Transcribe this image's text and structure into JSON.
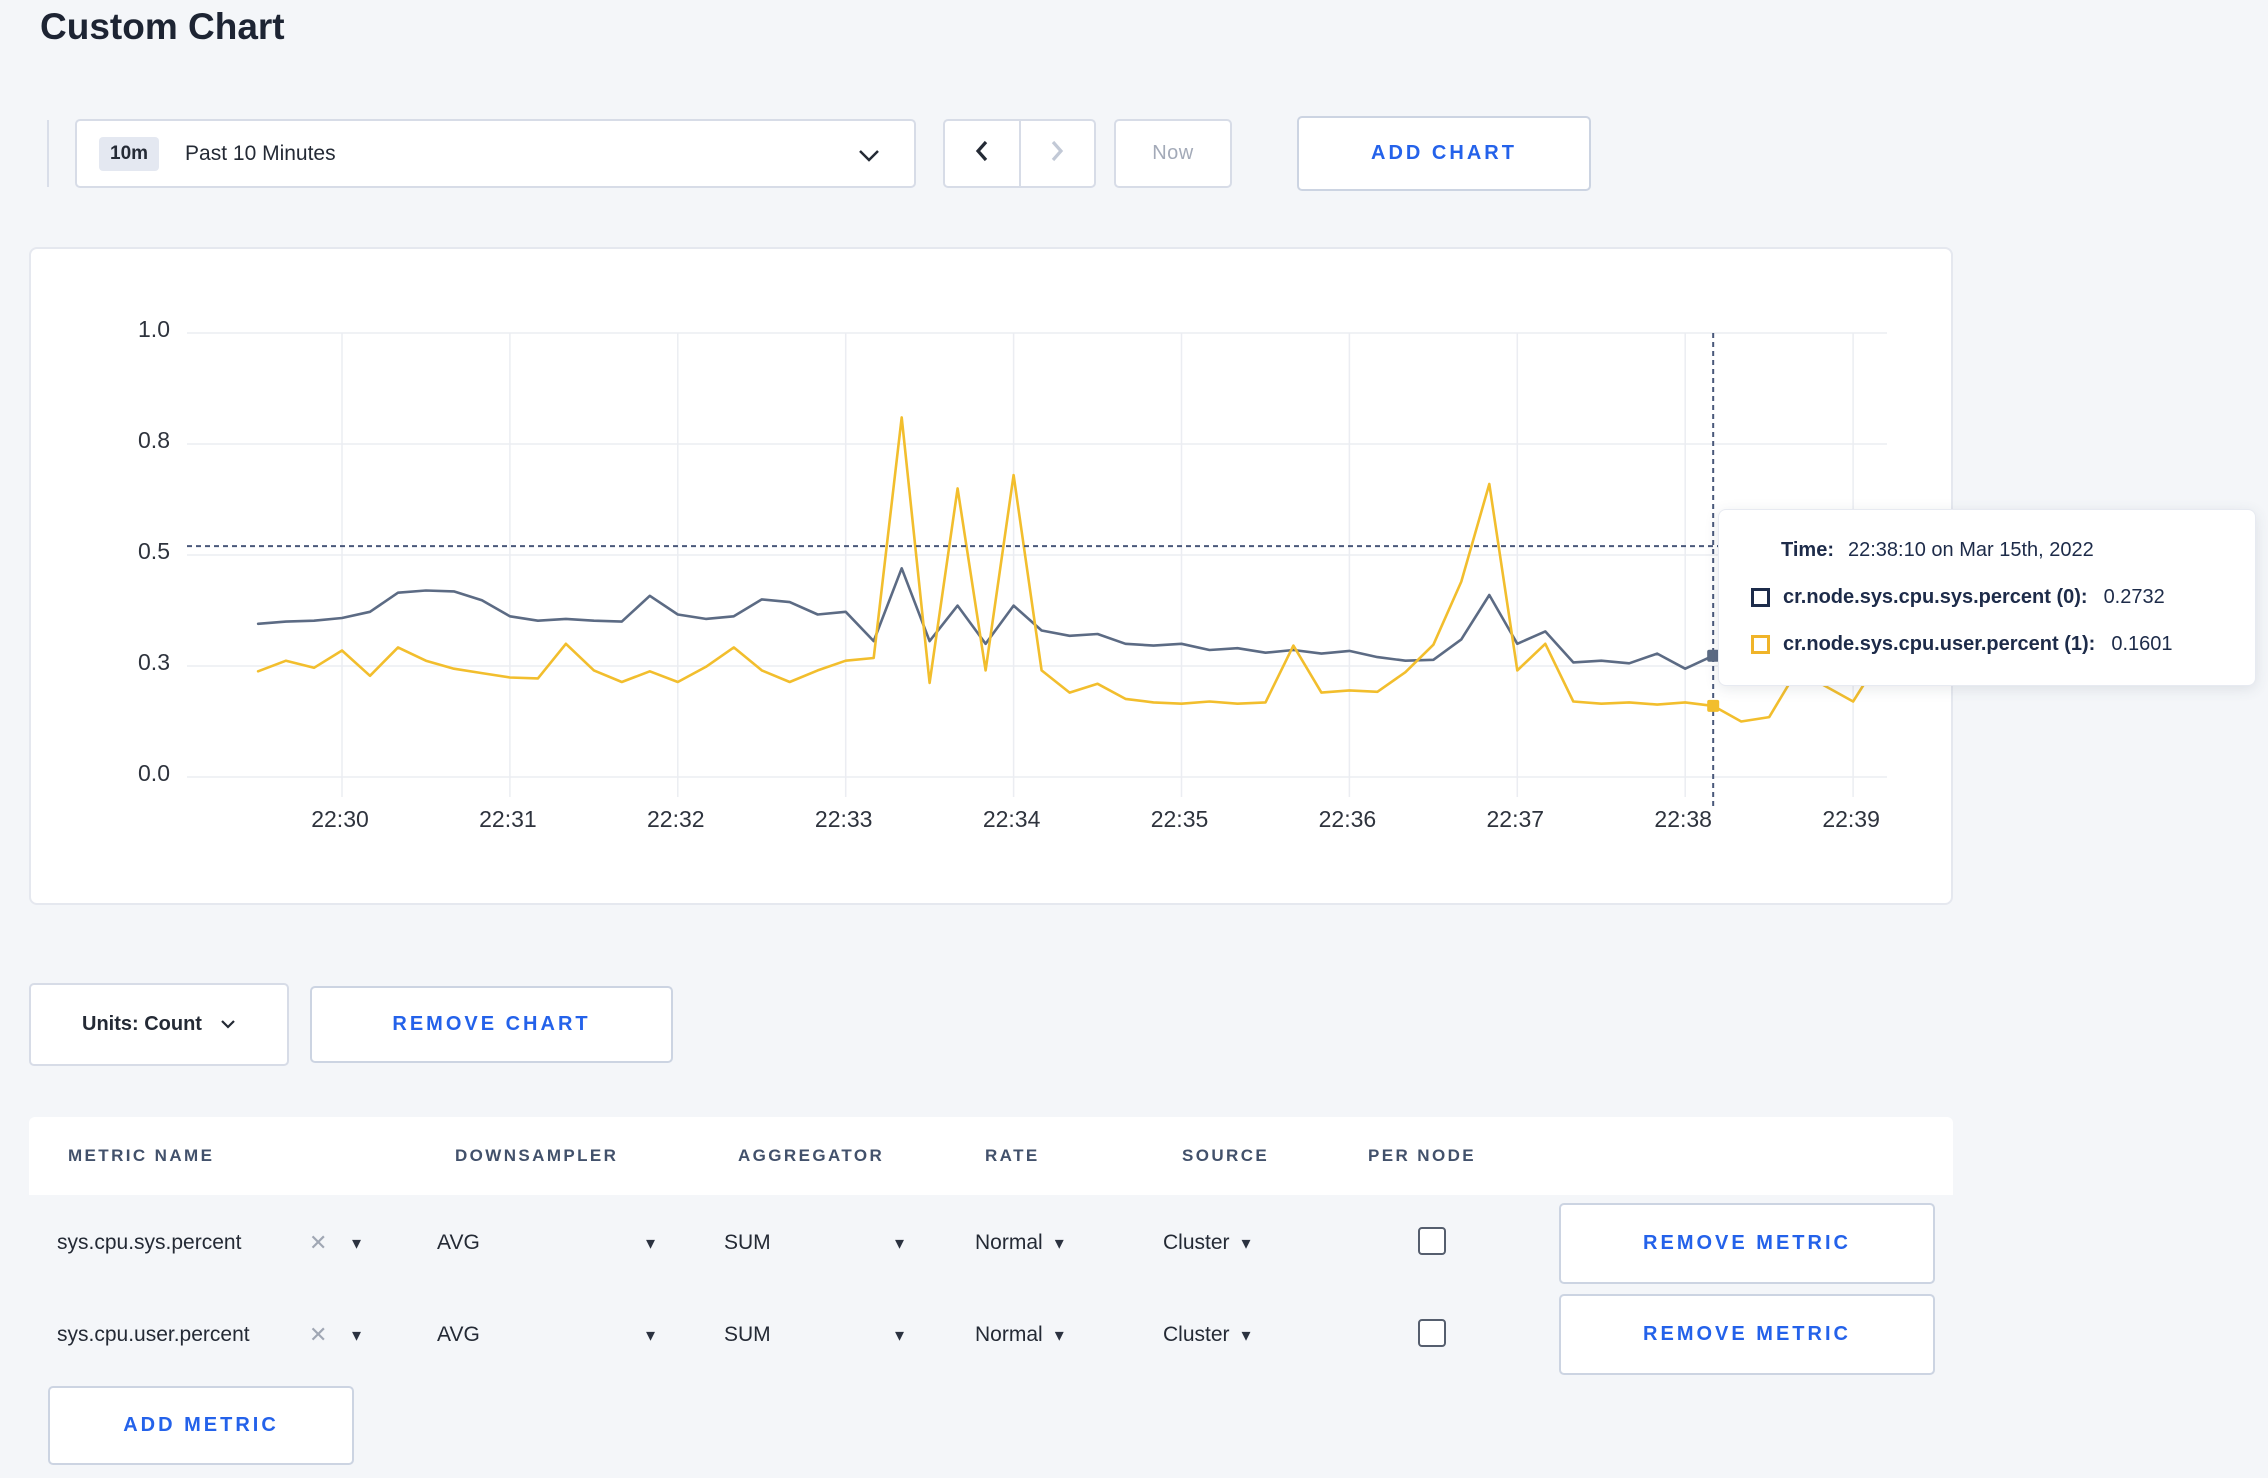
{
  "title": "Custom Chart",
  "toolbar": {
    "range_badge": "10m",
    "range_label": "Past 10 Minutes",
    "now_label": "Now",
    "add_chart_label": "ADD CHART"
  },
  "chart_actions": {
    "units_label": "Units: Count",
    "remove_chart_label": "REMOVE CHART",
    "add_metric_label": "ADD METRIC"
  },
  "tooltip": {
    "time_label": "Time:",
    "time_value": "22:38:10 on Mar 15th, 2022",
    "series": [
      {
        "label": "cr.node.sys.cpu.sys.percent (0):",
        "value": "0.2732",
        "color": "#1c2b4a"
      },
      {
        "label": "cr.node.sys.cpu.user.percent (1):",
        "value": "0.1601",
        "color": "#f0b429"
      }
    ]
  },
  "metrics_table": {
    "headers": [
      "METRIC NAME",
      "DOWNSAMPLER",
      "AGGREGATOR",
      "RATE",
      "SOURCE",
      "PER NODE"
    ],
    "remove_metric_label": "REMOVE METRIC",
    "rows": [
      {
        "name": "sys.cpu.sys.percent",
        "downsampler": "AVG",
        "aggregator": "SUM",
        "rate": "Normal",
        "source": "Cluster",
        "per_node_checked": false
      },
      {
        "name": "sys.cpu.user.percent",
        "downsampler": "AVG",
        "aggregator": "SUM",
        "rate": "Normal",
        "source": "Cluster",
        "per_node_checked": false
      }
    ]
  },
  "icons": {
    "caret_down": "▾",
    "close_x": "✕"
  },
  "colors": {
    "page_background": "#f4f6f9",
    "card_background": "#ffffff",
    "accent_blue": "#2462ea",
    "series_sys": "#5c6b84",
    "series_user": "#f2be2d",
    "crosshair": "#49587a",
    "grid": "#ebedf2"
  },
  "chart_data": {
    "type": "line",
    "title": "",
    "xlabel": "",
    "ylabel": "",
    "ylim": [
      0,
      1
    ],
    "grid": true,
    "legend_position": "tooltip-only",
    "y_ticks": [
      {
        "label": "1.0",
        "value": 1.0
      },
      {
        "label": "0.8",
        "value": 0.75
      },
      {
        "label": "0.5",
        "value": 0.5
      },
      {
        "label": "0.3",
        "value": 0.25
      },
      {
        "label": "0.0",
        "value": 0.0
      }
    ],
    "x_ticks": [
      "22:30",
      "22:31",
      "22:32",
      "22:33",
      "22:34",
      "22:35",
      "22:36",
      "22:37",
      "22:38",
      "22:39"
    ],
    "x_start_seconds": -30,
    "x_interval_seconds": 10,
    "series": [
      {
        "name": "cr.node.sys.cpu.sys.percent",
        "color": "#5c6b84",
        "values": [
          0.345,
          0.35,
          0.352,
          0.358,
          0.372,
          0.415,
          0.42,
          0.418,
          0.398,
          0.362,
          0.352,
          0.356,
          0.352,
          0.35,
          0.408,
          0.366,
          0.356,
          0.362,
          0.4,
          0.394,
          0.366,
          0.372,
          0.306,
          0.47,
          0.306,
          0.386,
          0.3,
          0.386,
          0.33,
          0.318,
          0.322,
          0.3,
          0.296,
          0.3,
          0.286,
          0.29,
          0.28,
          0.286,
          0.278,
          0.284,
          0.27,
          0.262,
          0.264,
          0.31,
          0.41,
          0.3,
          0.328,
          0.258,
          0.262,
          0.256,
          0.278,
          0.244,
          0.2732,
          0.248,
          0.262,
          0.285,
          0.27,
          0.29,
          0.278
        ]
      },
      {
        "name": "cr.node.sys.cpu.user.percent",
        "color": "#f2be2d",
        "values": [
          0.238,
          0.262,
          0.246,
          0.285,
          0.228,
          0.292,
          0.262,
          0.244,
          0.234,
          0.224,
          0.222,
          0.3,
          0.24,
          0.214,
          0.238,
          0.214,
          0.248,
          0.292,
          0.24,
          0.214,
          0.24,
          0.262,
          0.268,
          0.81,
          0.212,
          0.65,
          0.24,
          0.68,
          0.24,
          0.19,
          0.21,
          0.176,
          0.168,
          0.165,
          0.17,
          0.165,
          0.168,
          0.296,
          0.19,
          0.195,
          0.192,
          0.236,
          0.298,
          0.44,
          0.66,
          0.24,
          0.3,
          0.17,
          0.165,
          0.168,
          0.163,
          0.168,
          0.1601,
          0.125,
          0.135,
          0.24,
          0.205,
          0.17,
          0.27
        ]
      }
    ],
    "crosshair": {
      "time_label": "22:38:10",
      "x_seconds": 490,
      "hover_value": 0.52,
      "marker_values": [
        0.2732,
        0.1601
      ]
    }
  }
}
